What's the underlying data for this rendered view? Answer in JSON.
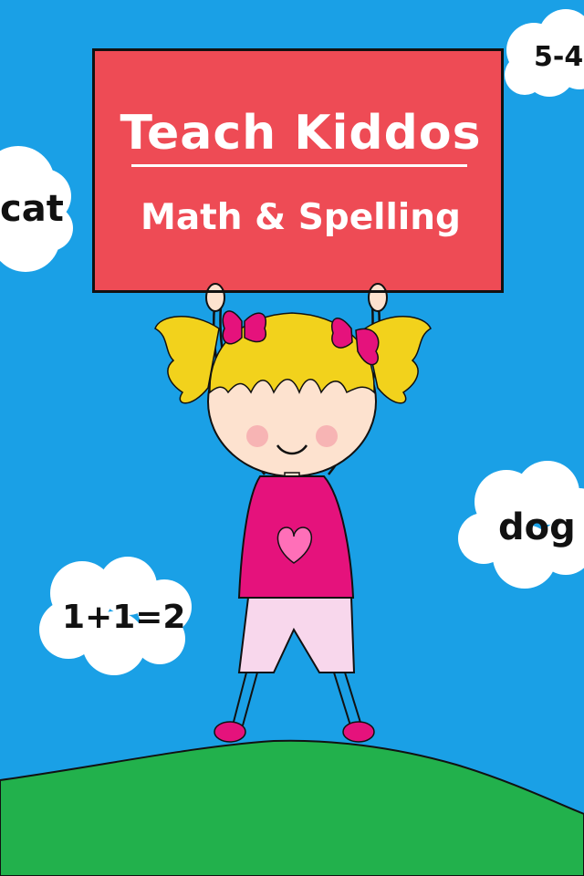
{
  "colors": {
    "sky": "#1aa0e6",
    "hill": "#22b14c",
    "sign": "#ee4b55",
    "shirt": "#e5127c",
    "shorts": "#f8d7ec",
    "hair": "#f2d21c",
    "skin": "#fde2cf",
    "cheek": "#f7b4b4",
    "cloud": "#ffffff"
  },
  "sign": {
    "title": "Teach Kiddos",
    "subtitle": "Math & Spelling"
  },
  "clouds": {
    "top_right": "5-4",
    "left": "cat",
    "right": "dog",
    "bottom_left": "1+1=2"
  }
}
